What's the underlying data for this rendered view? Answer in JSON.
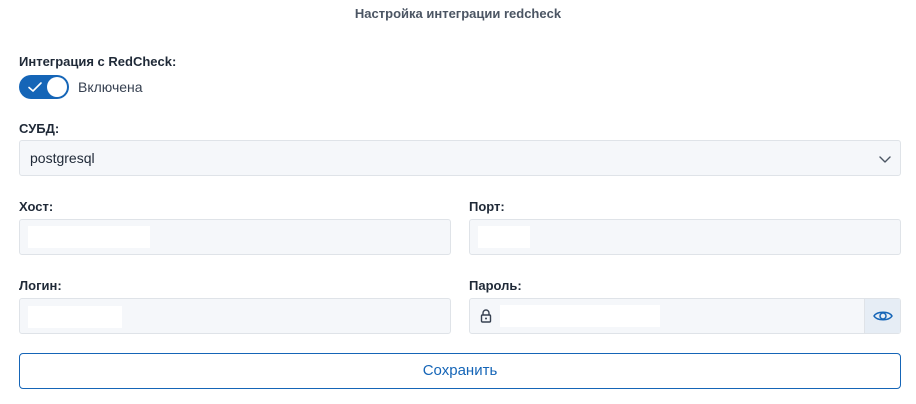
{
  "page": {
    "title": "Настройка интеграции redcheck"
  },
  "integration": {
    "label": "Интеграция с RedCheck:",
    "toggle_text": "Включена",
    "enabled": true
  },
  "dbms": {
    "label": "СУБД:",
    "value": "postgresql"
  },
  "host": {
    "label": "Хост:",
    "value": ""
  },
  "port": {
    "label": "Порт:",
    "value": ""
  },
  "login": {
    "label": "Логин:",
    "value": ""
  },
  "password": {
    "label": "Пароль:",
    "value": ""
  },
  "save_label": "Сохранить",
  "colors": {
    "accent": "#1565b7",
    "field_bg": "#f5f7fa",
    "border": "#dfe3e8"
  },
  "icons": [
    "check-icon",
    "chevron-down-icon",
    "lock-icon",
    "eye-icon"
  ]
}
